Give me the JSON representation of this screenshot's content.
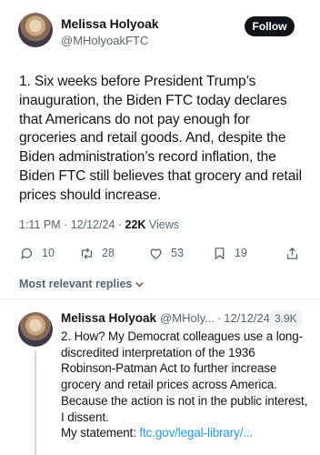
{
  "post": {
    "author_name": "Melissa Holyoak",
    "author_handle": "@MHolyoakFTC",
    "follow_label": "Follow",
    "text": "1. Six weeks before President Trump’s inauguration, the Biden FTC today declares that Americans do not pay enough for groceries and retail goods. And, despite the Biden administration’s record inflation, the Biden FTC still believes that grocery and retail prices should increase.",
    "meta_time_date": "1:11 PM · 12/12/24 · ",
    "views_count": "22K",
    "views_label": " Views",
    "reply_count": "10",
    "repost_count": "28",
    "like_count": "53",
    "bookmark_count": "19"
  },
  "sort": {
    "label": "Most relevant replies"
  },
  "reply": {
    "author_name": "Melissa Holyoak",
    "author_handle": "@MHoly...",
    "separator": "·",
    "date": "12/12/24",
    "views": "3.9K",
    "text": "2. How? My Democrat colleagues use a long-discredited interpretation of the 1936 Robinson-Patman Act to further increase grocery and retail prices across America. Because the action is not in the public interest, I dissent.",
    "statement_label": "My statement: ",
    "link_text": "ftc.gov/legal-library/..."
  },
  "icons": {
    "reply": "speech-bubble-icon",
    "repost": "repost-arrows-icon",
    "like": "heart-icon",
    "bookmark": "bookmark-icon",
    "share": "share-upload-icon",
    "sort": "chevron-down-icon"
  },
  "colors": {
    "text": "#0f1419",
    "secondary": "#536471",
    "link": "#1d9bf0",
    "follow_bg": "#0f1419",
    "divider": "#eff3f4"
  }
}
